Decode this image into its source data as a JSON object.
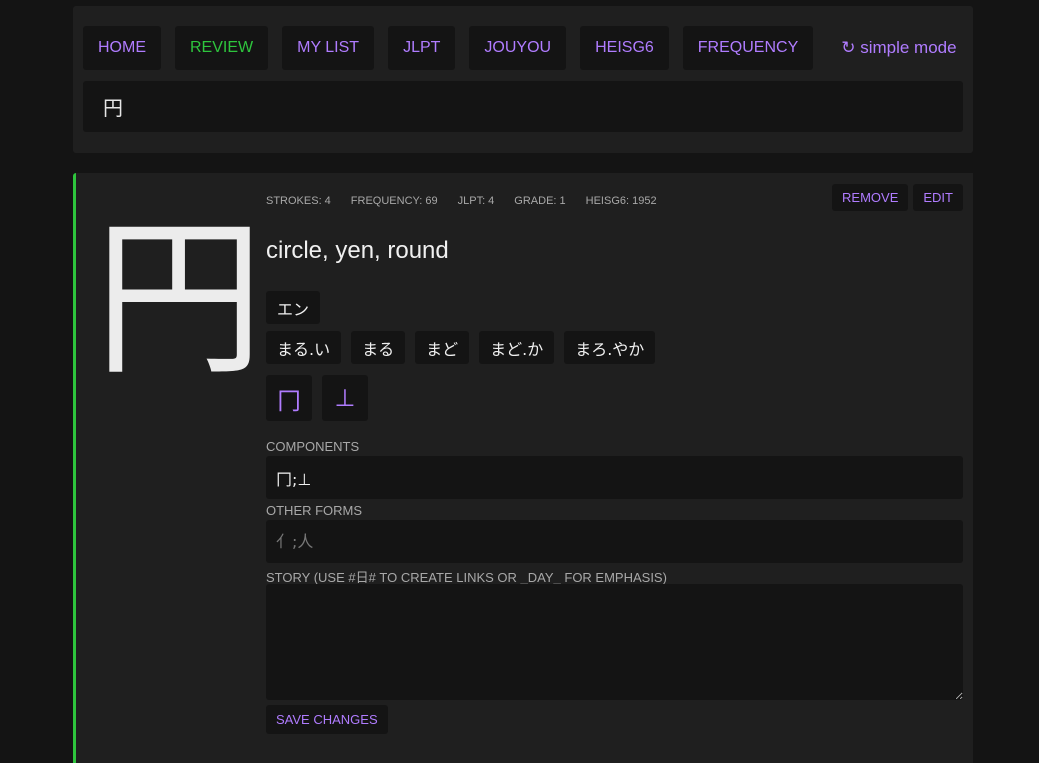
{
  "nav": {
    "items": [
      {
        "label": "HOME",
        "active": false
      },
      {
        "label": "REVIEW",
        "active": true
      },
      {
        "label": "MY LIST",
        "active": false
      },
      {
        "label": "JLPT",
        "active": false
      },
      {
        "label": "JOUYOU",
        "active": false
      },
      {
        "label": "HEISG6",
        "active": false
      },
      {
        "label": "FREQUENCY",
        "active": false
      }
    ],
    "simple_mode_label": "↻ simple mode"
  },
  "search": {
    "value": "円"
  },
  "kanji": {
    "character": "円",
    "stats": {
      "strokes": "STROKES: 4",
      "frequency": "FREQUENCY: 69",
      "jlpt": "JLPT: 4",
      "grade": "GRADE: 1",
      "heisg6": "HEISG6: 1952"
    },
    "actions": {
      "remove": "REMOVE",
      "edit": "EDIT"
    },
    "meaning": "circle, yen, round",
    "onyomi": [
      "エン"
    ],
    "kunyomi": [
      "まる.い",
      "まる",
      "まど",
      "まど.か",
      "まろ.やか"
    ],
    "components": [
      "冂",
      "⊥"
    ]
  },
  "form": {
    "components_label": "COMPONENTS",
    "components_value": "冂;⊥",
    "other_forms_label": "OTHER FORMS",
    "other_forms_placeholder": "亻;人",
    "story_label": "STORY (USE #日# TO CREATE LINKS OR _DAY_ FOR EMPHASIS)",
    "story_value": "",
    "save_label": "SAVE CHANGES"
  },
  "colors": {
    "accent": "#b07cff",
    "active": "#2ec53d",
    "background": "#141414",
    "panel": "#1f1f1f"
  }
}
